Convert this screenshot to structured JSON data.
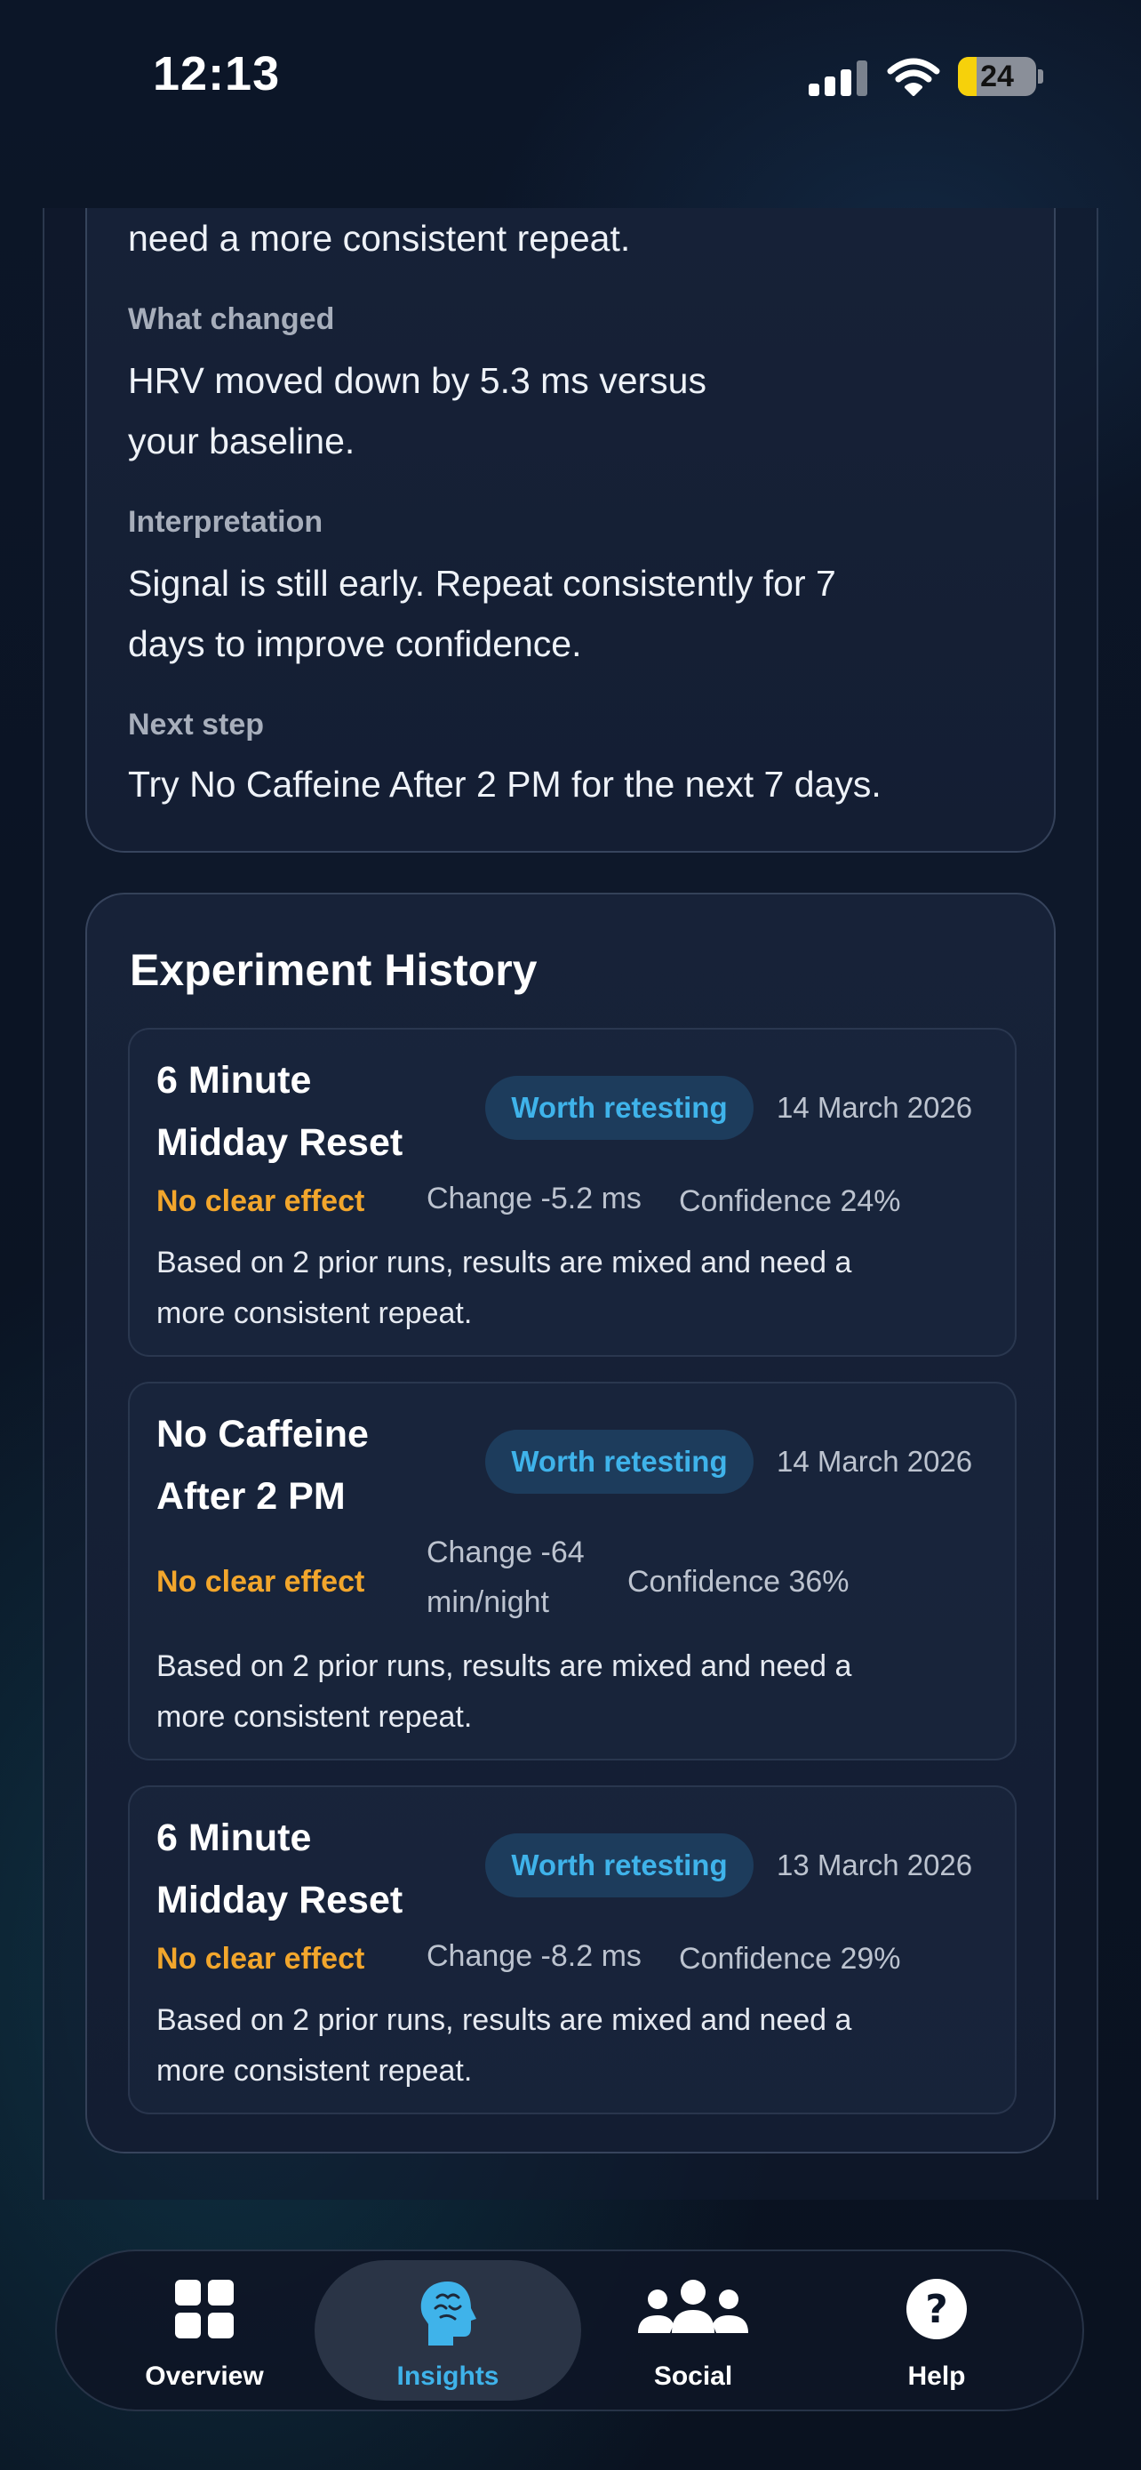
{
  "status_bar": {
    "time": "12:13",
    "battery": "24"
  },
  "insight": {
    "partial_line": "need a more consistent repeat.",
    "what_changed_label": "What changed",
    "what_changed_line1": "HRV moved down by 5.3 ms versus",
    "what_changed_line2": "your baseline.",
    "interpretation_label": "Interpretation",
    "interpretation_line1": "Signal is still early. Repeat consistently for 7",
    "interpretation_line2": "days to improve confidence.",
    "next_step_label": "Next step",
    "next_step_text": "Try No Caffeine After 2 PM for the next 7 days."
  },
  "history": {
    "title": "Experiment History",
    "items": [
      {
        "name_line1": "6 Minute",
        "name_line2": "Midday Reset",
        "badge": "Worth retesting",
        "date": "14 March 2026",
        "effect": "No clear effect",
        "change": "Change -5.2 ms",
        "confidence": "Confidence 24%",
        "desc_line1": "Based on 2 prior runs, results are mixed and need a",
        "desc_line2": "more consistent repeat."
      },
      {
        "name_line1": "No Caffeine",
        "name_line2": "After 2 PM",
        "badge": "Worth retesting",
        "date": "14 March 2026",
        "effect": "No clear effect",
        "change_line1": "Change -64",
        "change_line2": "min/night",
        "confidence": "Confidence 36%",
        "desc_line1": "Based on 2 prior runs, results are mixed and need a",
        "desc_line2": "more consistent repeat."
      },
      {
        "name_line1": "6 Minute",
        "name_line2": "Midday Reset",
        "badge": "Worth retesting",
        "date": "13 March 2026",
        "effect": "No clear effect",
        "change": "Change -8.2 ms",
        "confidence": "Confidence 29%",
        "desc_line1": "Based on 2 prior runs, results are mixed and need a",
        "desc_line2": "more consistent repeat."
      }
    ]
  },
  "tabs": [
    {
      "label": "Overview",
      "icon": "grid-icon",
      "active": false
    },
    {
      "label": "Insights",
      "icon": "brain-icon",
      "active": true
    },
    {
      "label": "Social",
      "icon": "people-icon",
      "active": false
    },
    {
      "label": "Help",
      "icon": "help-icon",
      "active": false
    }
  ],
  "colors": {
    "accent": "#3fb3ea",
    "warning": "#f2a62c",
    "battery": "#f6d10b"
  }
}
